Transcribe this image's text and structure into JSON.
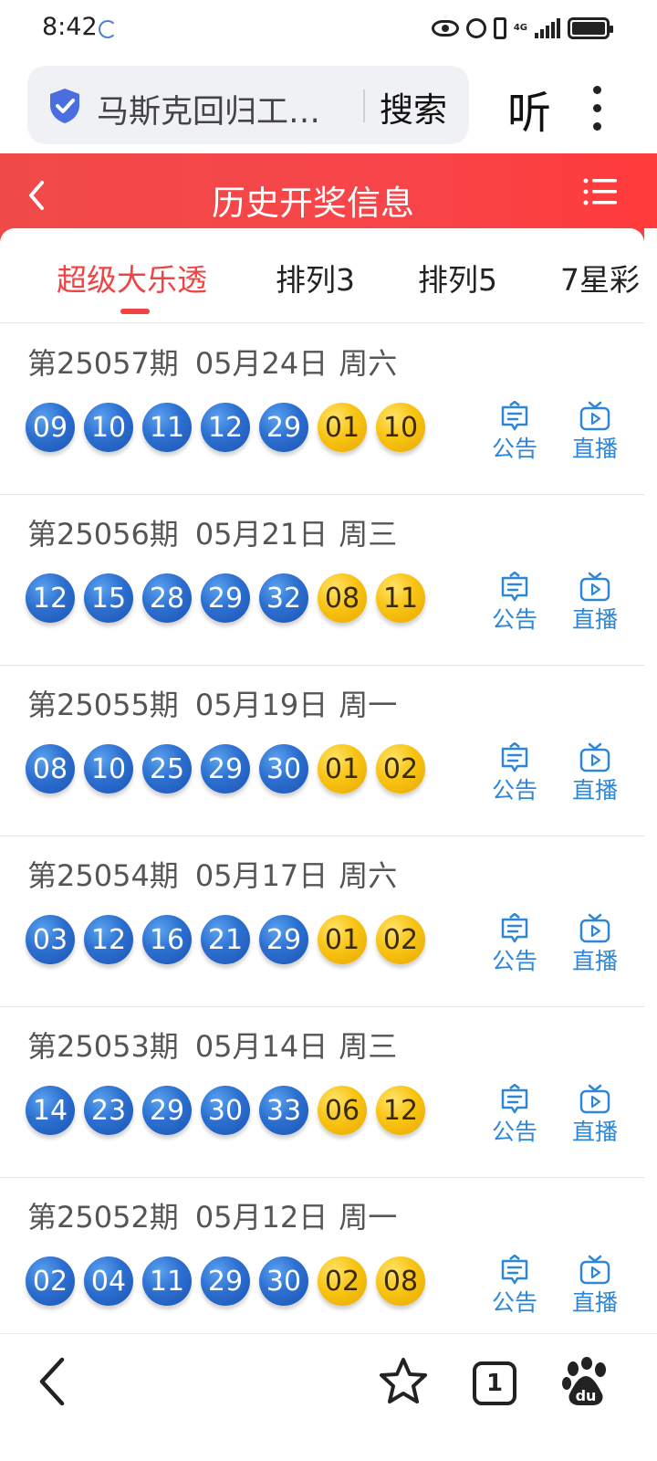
{
  "status_bar": {
    "time": "8:42",
    "network": "4G"
  },
  "browser": {
    "url_title": "马斯克回归工…",
    "search_label": "搜索",
    "listen_label": "听"
  },
  "header": {
    "title": "历史开奖信息"
  },
  "tabs": [
    {
      "label": "超级大乐透",
      "active": true
    },
    {
      "label": "排列3",
      "active": false
    },
    {
      "label": "排列5",
      "active": false
    },
    {
      "label": "7星彩",
      "active": false
    }
  ],
  "draws": [
    {
      "issue": "第25057期",
      "date": "05月24日",
      "weekday": "周六",
      "front": [
        "09",
        "10",
        "11",
        "12",
        "29"
      ],
      "back": [
        "01",
        "10"
      ]
    },
    {
      "issue": "第25056期",
      "date": "05月21日",
      "weekday": "周三",
      "front": [
        "12",
        "15",
        "28",
        "29",
        "32"
      ],
      "back": [
        "08",
        "11"
      ]
    },
    {
      "issue": "第25055期",
      "date": "05月19日",
      "weekday": "周一",
      "front": [
        "08",
        "10",
        "25",
        "29",
        "30"
      ],
      "back": [
        "01",
        "02"
      ]
    },
    {
      "issue": "第25054期",
      "date": "05月17日",
      "weekday": "周六",
      "front": [
        "03",
        "12",
        "16",
        "21",
        "29"
      ],
      "back": [
        "01",
        "02"
      ]
    },
    {
      "issue": "第25053期",
      "date": "05月14日",
      "weekday": "周三",
      "front": [
        "14",
        "23",
        "29",
        "30",
        "33"
      ],
      "back": [
        "06",
        "12"
      ]
    },
    {
      "issue": "第25052期",
      "date": "05月12日",
      "weekday": "周一",
      "front": [
        "02",
        "04",
        "11",
        "29",
        "30"
      ],
      "back": [
        "02",
        "08"
      ]
    }
  ],
  "actions": {
    "notice_label": "公告",
    "live_label": "直播"
  },
  "bottom_nav": {
    "tab_count": "1"
  },
  "colors": {
    "header_red": "#f7454a",
    "front_ball_blue": "#2c6fd0",
    "back_ball_gold": "#f8c413",
    "action_blue": "#2d86d8"
  }
}
